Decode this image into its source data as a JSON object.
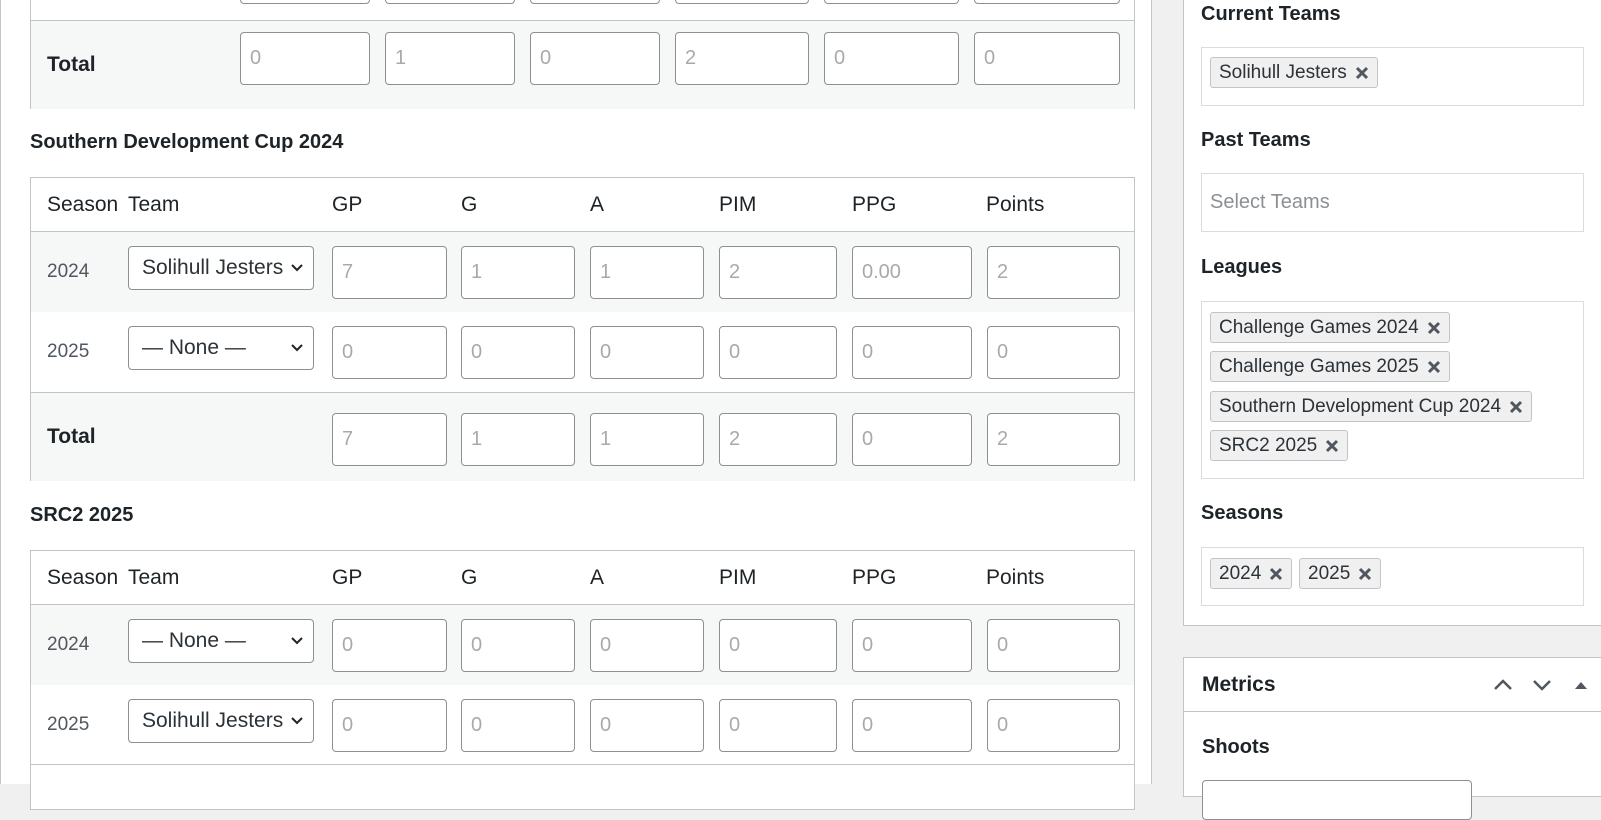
{
  "headers": {
    "season": "Season",
    "team": "Team",
    "gp": "GP",
    "g": "G",
    "a": "A",
    "pim": "PIM",
    "ppg": "PPG",
    "points": "Points"
  },
  "top_table": {
    "total_label": "Total",
    "total": [
      "0",
      "1",
      "0",
      "2",
      "0",
      "0"
    ]
  },
  "sdc": {
    "title": "Southern Development Cup 2024",
    "rows": [
      {
        "season": "2024",
        "team": "Solihull Jesters",
        "gp": "7",
        "g": "1",
        "a": "1",
        "pim": "2",
        "ppg": "0.00",
        "points": "2"
      },
      {
        "season": "2025",
        "team": "— None —",
        "gp": "0",
        "g": "0",
        "a": "0",
        "pim": "0",
        "ppg": "0",
        "points": "0"
      }
    ],
    "total_label": "Total",
    "total": {
      "gp": "7",
      "g": "1",
      "a": "1",
      "pim": "2",
      "ppg": "0",
      "points": "2"
    }
  },
  "src2": {
    "title": "SRC2 2025",
    "rows": [
      {
        "season": "2024",
        "team": "— None —",
        "gp": "0",
        "g": "0",
        "a": "0",
        "pim": "0",
        "ppg": "0",
        "points": "0"
      },
      {
        "season": "2025",
        "team": "Solihull Jesters",
        "gp": "0",
        "g": "0",
        "a": "0",
        "pim": "0",
        "ppg": "0",
        "points": "0"
      }
    ]
  },
  "sidebar": {
    "current_teams": {
      "label": "Current Teams",
      "chips": [
        "Solihull Jesters"
      ]
    },
    "past_teams": {
      "label": "Past Teams",
      "placeholder": "Select Teams"
    },
    "leagues": {
      "label": "Leagues",
      "chips": [
        "Challenge Games 2024",
        "Challenge Games 2025",
        "Southern Development Cup 2024",
        "SRC2 2025"
      ]
    },
    "seasons": {
      "label": "Seasons",
      "chips": [
        "2024",
        "2025"
      ]
    },
    "metrics": {
      "title": "Metrics",
      "shoots_label": "Shoots"
    }
  },
  "colors": {
    "border": "#c3c4c7",
    "input_border": "#8c8f94",
    "muted_text": "#a7aaad",
    "chip_bg": "#f0f0f1"
  },
  "icons": {
    "select": "chevron-down-icon",
    "chip_remove": "close-icon",
    "metrics_controls": [
      "chevron-up-icon",
      "chevron-down-icon",
      "triangle-up-icon"
    ]
  }
}
